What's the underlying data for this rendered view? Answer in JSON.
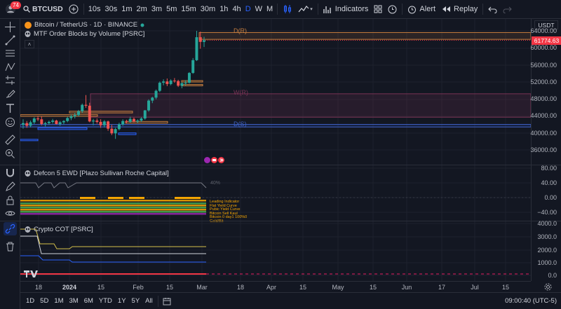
{
  "header": {
    "symbol": "BTCUSD",
    "notification_count": "74",
    "intervals": [
      "10s",
      "30s",
      "1m",
      "2m",
      "3m",
      "5m",
      "15m",
      "30m",
      "1h",
      "4h",
      "D",
      "W",
      "M"
    ],
    "active_interval": "D",
    "indicators_label": "Indicators",
    "alert_label": "Alert",
    "replay_label": "Replay"
  },
  "main_pane": {
    "title": "Bitcoin / TetherUS · 1D · BINANCE",
    "indicator_name": "MTF Order Blocks by Volume [PSRC]",
    "labels": {
      "d_top": "D(R)",
      "w_mid": "W(R)",
      "d_low": "D(S)"
    },
    "currency": "USDT",
    "last_price": "61774.63",
    "price_ticks": [
      "64000.00",
      "60000.00",
      "56000.00",
      "52000.00",
      "48000.00",
      "44000.00",
      "40000.00",
      "36000.00"
    ]
  },
  "defcon_pane": {
    "title": "Defcon 5 EWD [Plazo Sullivan Roche Capital]",
    "value_label": "40%",
    "ticks": [
      "80.00",
      "40.00",
      "0.00",
      "−40.00"
    ],
    "row_labels": [
      "Leading Indicator",
      "Flat Yield Curve",
      "Pubic Yield Curve",
      "Bitcoin Sell Kaul",
      "Bitcoin 0 day1 100%0",
      "Gold/Bit"
    ]
  },
  "cot_pane": {
    "title": "Crypto COT [PSRC]",
    "ticks": [
      "4000.0",
      "3000.0",
      "2000.0",
      "1000.0",
      "0.0"
    ]
  },
  "time_axis": {
    "labels": [
      {
        "t": "18",
        "b": false
      },
      {
        "t": "2024",
        "b": true
      },
      {
        "t": "15",
        "b": false
      },
      {
        "t": "Feb",
        "b": false
      },
      {
        "t": "15",
        "b": false
      },
      {
        "t": "Mar",
        "b": false
      },
      {
        "t": "18",
        "b": false
      },
      {
        "t": "Apr",
        "b": false
      },
      {
        "t": "15",
        "b": false
      },
      {
        "t": "May",
        "b": false
      },
      {
        "t": "15",
        "b": false
      },
      {
        "t": "Jun",
        "b": false
      },
      {
        "t": "17",
        "b": false
      },
      {
        "t": "Jul",
        "b": false
      },
      {
        "t": "15",
        "b": false
      }
    ]
  },
  "bottom": {
    "ranges": [
      "1D",
      "5D",
      "1M",
      "3M",
      "6M",
      "YTD",
      "1Y",
      "5Y",
      "All"
    ],
    "clock": "09:00:40 (UTC-5)"
  },
  "chart_data": {
    "type": "candlestick",
    "series_name": "Bitcoin / TetherUS · 1D · BINANCE",
    "ylim": [
      32000,
      67000
    ],
    "last_close": 61774.63,
    "candles": [
      [
        41900,
        43200,
        41000,
        42300
      ],
      [
        42300,
        42800,
        41200,
        41700
      ],
      [
        41700,
        42900,
        41300,
        42500
      ],
      [
        42500,
        43700,
        42100,
        43400
      ],
      [
        43400,
        44000,
        42800,
        43200
      ],
      [
        43200,
        43900,
        41800,
        42100
      ],
      [
        42100,
        42600,
        41500,
        42300
      ],
      [
        42300,
        42900,
        41900,
        42600
      ],
      [
        42600,
        43300,
        42200,
        42900
      ],
      [
        42900,
        43100,
        42000,
        42100
      ],
      [
        42100,
        42800,
        41700,
        42500
      ],
      [
        42500,
        43000,
        42000,
        42800
      ],
      [
        42800,
        43800,
        42500,
        43500
      ],
      [
        43500,
        44300,
        43000,
        43900
      ],
      [
        43900,
        44700,
        43400,
        44200
      ],
      [
        44200,
        45400,
        43900,
        45100
      ],
      [
        45100,
        46900,
        44700,
        46600
      ],
      [
        46600,
        48900,
        45900,
        46400
      ],
      [
        46400,
        47100,
        42500,
        42700
      ],
      [
        42700,
        43300,
        41800,
        42900
      ],
      [
        42900,
        43400,
        42200,
        42600
      ],
      [
        42600,
        43200,
        41200,
        41800
      ],
      [
        41800,
        43000,
        41300,
        42700
      ],
      [
        42700,
        42900,
        40500,
        41000
      ],
      [
        41000,
        41900,
        39500,
        39900
      ],
      [
        39900,
        41200,
        38600,
        40900
      ],
      [
        40900,
        42400,
        40600,
        42000
      ],
      [
        42000,
        43200,
        41700,
        42800
      ],
      [
        42800,
        43100,
        42200,
        42600
      ],
      [
        42600,
        43800,
        42400,
        43300
      ],
      [
        43300,
        43600,
        42500,
        42700
      ],
      [
        42700,
        43200,
        42300,
        42900
      ],
      [
        42900,
        43700,
        42600,
        43400
      ],
      [
        43400,
        45400,
        43100,
        45300
      ],
      [
        45300,
        47900,
        45000,
        47600
      ],
      [
        47600,
        48500,
        47000,
        48300
      ],
      [
        48300,
        50200,
        47900,
        49900
      ],
      [
        49900,
        52100,
        49600,
        51800
      ],
      [
        51800,
        52600,
        51200,
        52100
      ],
      [
        52100,
        52800,
        51000,
        51500
      ],
      [
        51500,
        52600,
        51200,
        52300
      ],
      [
        52300,
        52900,
        51800,
        52200
      ],
      [
        52200,
        52500,
        50800,
        51100
      ],
      [
        51100,
        51900,
        50500,
        51700
      ],
      [
        51700,
        52400,
        51200,
        51800
      ],
      [
        51800,
        54300,
        51600,
        54100
      ],
      [
        54100,
        57600,
        53900,
        57100
      ],
      [
        57100,
        64000,
        56900,
        62500
      ],
      [
        62500,
        63800,
        59800,
        61400
      ],
      [
        61400,
        62600,
        60200,
        61774.63
      ]
    ],
    "order_blocks": [
      {
        "label": "D(R)",
        "top": 63600,
        "bottom": 62000
      },
      {
        "label": "W(R)",
        "top": 49200,
        "bottom": 43700
      },
      {
        "label": "D(S)",
        "top": 42000,
        "bottom": 41400
      }
    ]
  }
}
